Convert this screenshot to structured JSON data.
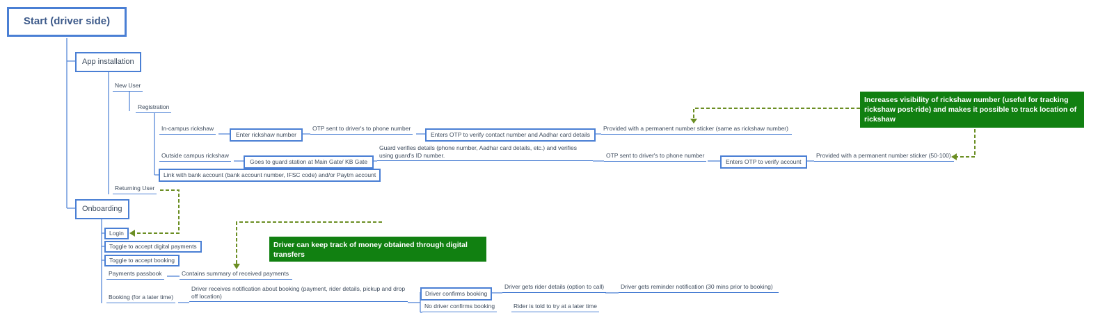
{
  "diagram": {
    "root": "Start (driver side)",
    "app_installation": "App installation",
    "new_user": "New User",
    "registration": "Registration",
    "in_campus_rickshaw": "In-campus rickshaw",
    "enter_rickshaw_number": "Enter rickshaw number",
    "otp_sent_1": "OTP sent to driver's to phone number",
    "enters_otp_verify_aadhar": "Enters OTP to verify contact number and Aadhar card details",
    "sticker_same": "Provided with a permanent number sticker (same as rickshaw number)",
    "outside_campus_rickshaw": "Outside campus rickshaw",
    "goes_to_guard": "Goes to guard station at Main Gate/ KB Gate",
    "guard_verifies": "Guard verifies details (phone number, Aadhar card details, etc.) and verifies using guard's ID number.",
    "otp_sent_2": "OTP sent to driver's to phone number",
    "enters_otp_verify_account": "Enters OTP to verify account",
    "sticker_50_100": "Provided with a permanent number sticker (50-100)",
    "link_bank": "Link with bank account (bank account number, IFSC code) and/or Paytm account",
    "returning_user": "Returning User",
    "onboarding": "Onboarding",
    "login": "Login",
    "toggle_digital": "Toggle to accept digital payments",
    "toggle_booking": "Toggle to accept booking",
    "payments_passbook": "Payments passbook",
    "contains_summary": "Contains summary of received payments",
    "booking_later": "Booking (for a later time)",
    "driver_receives_notification": "Driver receives notification about booking (payment, rider details, pickup and drop off location)",
    "driver_confirms_booking": "Driver confirms booking",
    "driver_gets_rider_details": "Driver gets rider details (option to call)",
    "driver_gets_reminder": "Driver gets reminder notification (30 mins prior to booking)",
    "no_driver_confirms": "No driver confirms booking",
    "rider_told_try_later": "Rider is told to try at a later time"
  },
  "callouts": {
    "visibility": "Increases visibility of rickshaw number (useful for tracking rickshaw post-ride) and makes it possible to track location of rickshaw",
    "money_tracking": "Driver can keep track of money obtained through digital transfers"
  },
  "colors": {
    "line": "#4a7fd4",
    "callout_bg": "#118011",
    "dashed_arrow": "#6b8e23",
    "text": "#3c4a5c"
  }
}
